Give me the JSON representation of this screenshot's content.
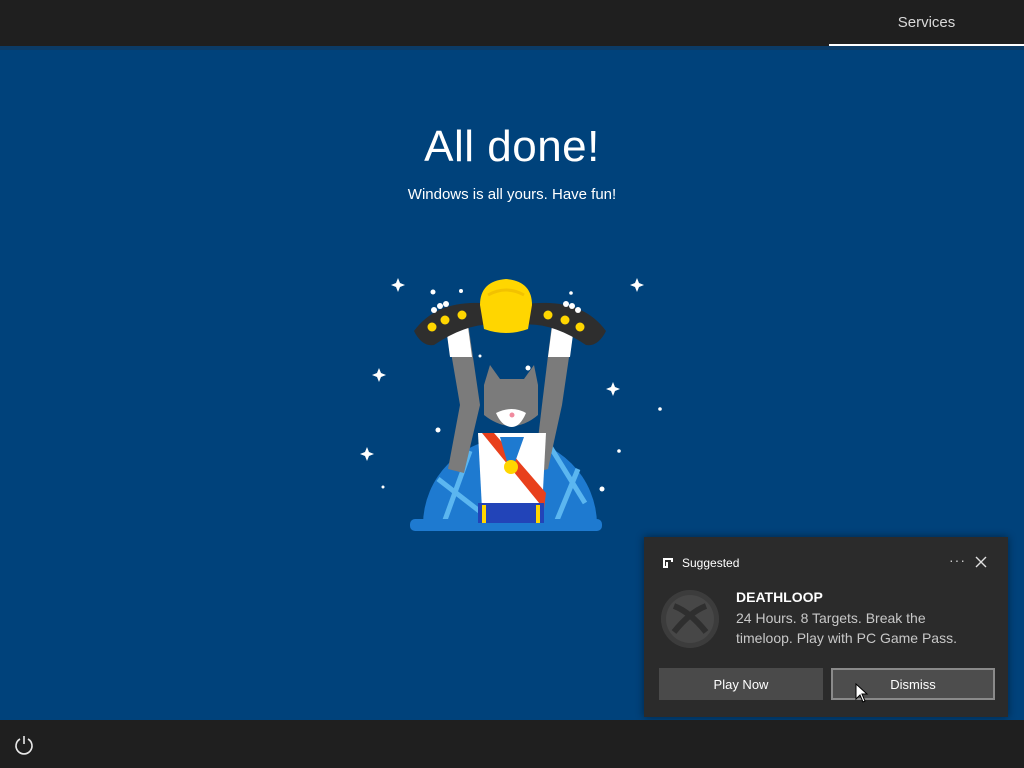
{
  "header": {
    "tab_label": "Services"
  },
  "main": {
    "title": "All done!",
    "subtitle": "Windows is all yours. Have fun!"
  },
  "toast": {
    "header_label": "Suggested",
    "more_label": "···",
    "app_title": "DEATHLOOP",
    "body": "24 Hours. 8 Targets. Break the timeloop. Play with PC Game Pass.",
    "primary_button": "Play Now",
    "secondary_button": "Dismiss"
  },
  "icons": [
    "power-icon",
    "close-icon",
    "more-icon",
    "app-grid-icon",
    "xbox-logo-icon"
  ],
  "colors": {
    "background": "#00427b",
    "bars": "#1f1f1f",
    "toast": "#2b2b2b",
    "button": "#4a4a4a"
  }
}
